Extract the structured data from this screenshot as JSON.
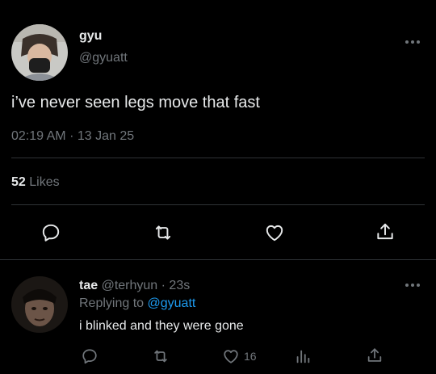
{
  "main_tweet": {
    "display_name": "gyu",
    "handle": "@gyuatt",
    "text": "i’ve never seen legs move that fast",
    "time": "02:19 AM",
    "separator": "·",
    "date": "13 Jan 25",
    "likes_count": "52",
    "likes_label": "Likes"
  },
  "reply": {
    "display_name": "tae",
    "handle": "@terhyun",
    "separator": "·",
    "age": "23s",
    "replying_prefix": "Replying to",
    "replying_to": "@gyuatt",
    "text": "i blinked and they were gone",
    "likes": "16"
  },
  "icons": {
    "main_actions": [
      "reply-icon",
      "retweet-icon",
      "like-icon",
      "share-icon"
    ],
    "reply_actions": [
      "reply-icon",
      "retweet-icon",
      "like-icon",
      "analytics-icon",
      "share-icon"
    ],
    "more": "more-icon"
  },
  "colors": {
    "background": "#000000",
    "text": "#e7e9ea",
    "muted": "#71767b",
    "accent": "#1d9bf0",
    "divider": "#2f3336"
  }
}
